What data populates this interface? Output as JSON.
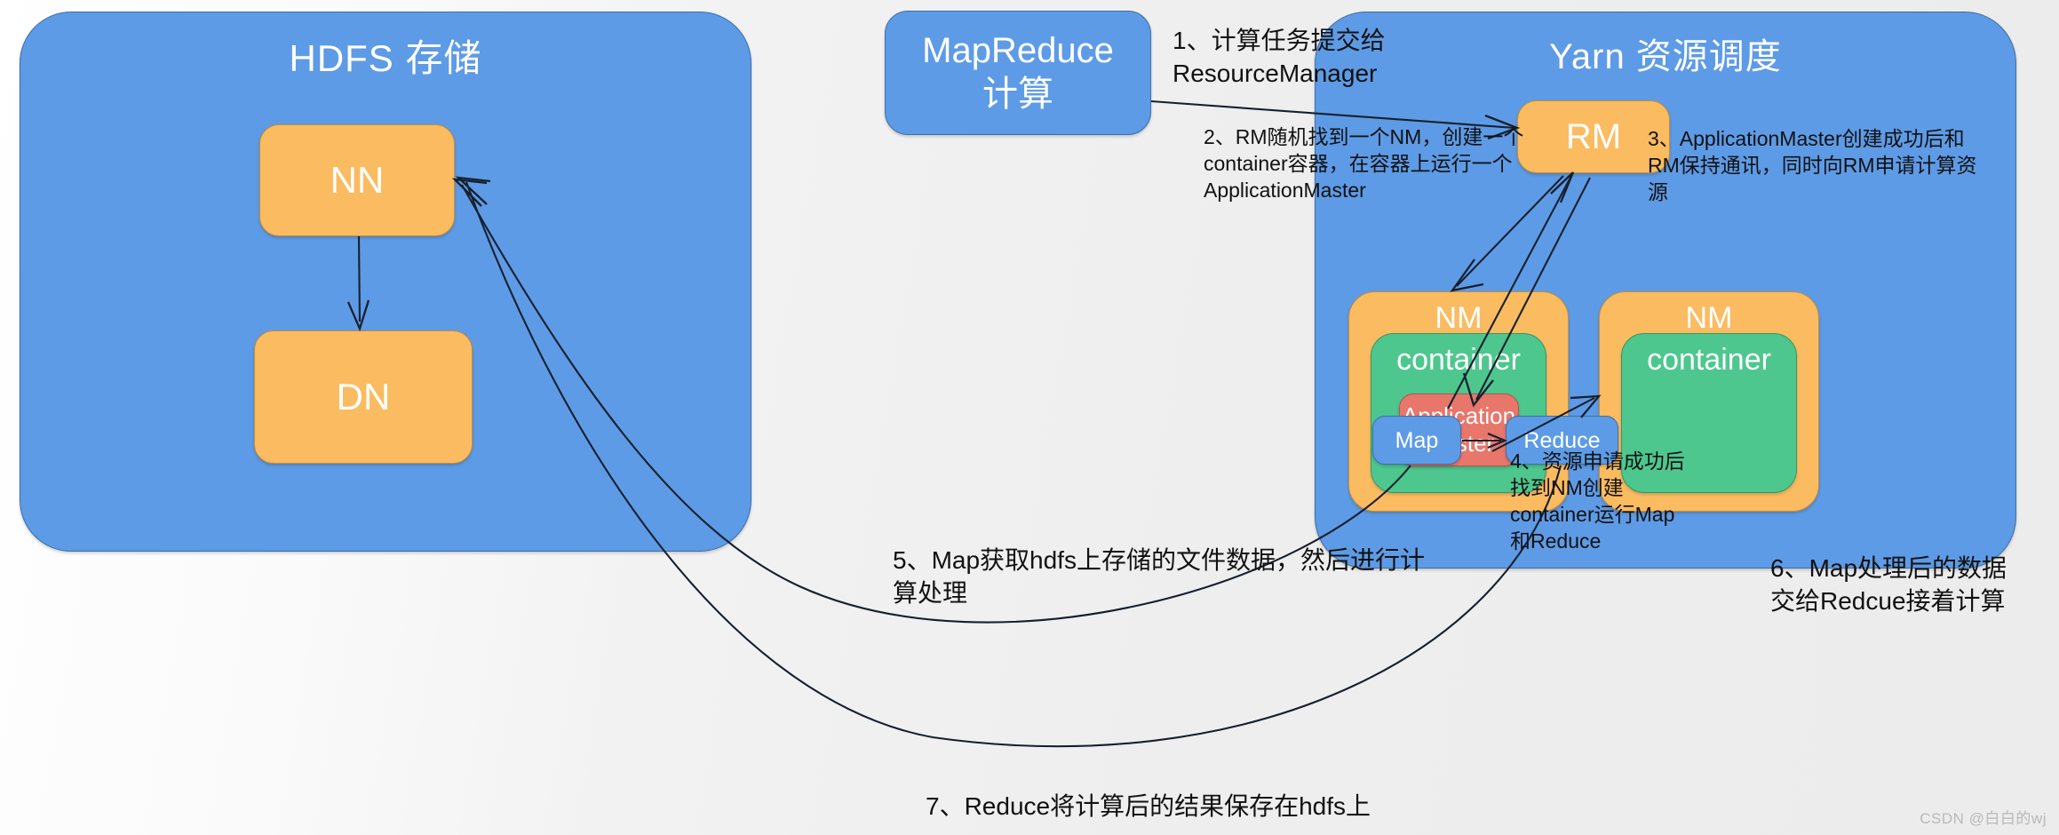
{
  "diagram": {
    "title_hdfs": "HDFS 存储",
    "title_mapreduce": "MapReduce\n计算",
    "title_yarn": "Yarn 资源调度",
    "nodes": {
      "nn": "NN",
      "dn": "DN",
      "rm": "RM",
      "nm_left": "NM",
      "nm_right": "NM",
      "container_left": "container",
      "container_right": "container",
      "application_master": "Application\nMaster",
      "map": "Map",
      "reduce": "Reduce"
    },
    "steps": {
      "step1": "1、计算任务提交给\nResourceManager",
      "step2": "2、RM随机找到一个NM，创建一个\ncontainer容器，在容器上运行一个\nApplicationMaster",
      "step3": "3、ApplicationMaster创建成功后和\nRM保持通讯，同时向RM申请计算资\n源",
      "step4": "4、资源申请成功后\n找到NM创建\ncontainer运行Map\n和Reduce",
      "step5": "5、Map获取hdfs上存储的文件数据，然后进行计\n算处理",
      "step6": "6、Map处理后的数据\n交给Redcue接着计算",
      "step7": "7、Reduce将计算后的结果保存在hdfs上"
    },
    "watermark": "CSDN @白白的wj",
    "colors": {
      "group_blue": "#5E9BE6",
      "node_orange": "#FBBB61",
      "container_green": "#4DC78E",
      "app_master_red": "#E8766B",
      "node_blue": "#5E9BE6",
      "canvas": "#eeeeee",
      "arrow": "#16202e",
      "watermark": "#b9b9b9"
    }
  }
}
